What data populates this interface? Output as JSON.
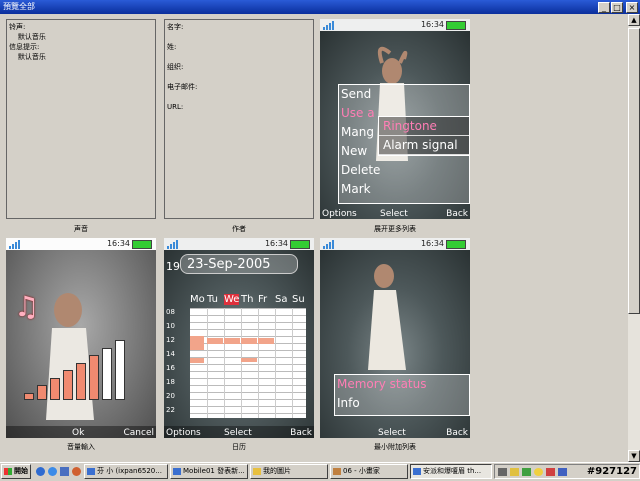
{
  "window": {
    "title": "預覽全部",
    "buttons": {
      "minimize": "_",
      "maximize": "□",
      "close": "×"
    }
  },
  "panels": {
    "sound": {
      "caption": "声音",
      "lines": [
        "铃声:",
        "    默认音乐",
        "信息提示:",
        "    默认音乐"
      ]
    },
    "author": {
      "caption": "作者",
      "lines": [
        "名字:",
        "",
        "姓:",
        "",
        "组织:",
        "",
        "电子邮件:",
        "",
        "URL:"
      ]
    }
  },
  "phones": {
    "common": {
      "time": "16:34"
    },
    "popup_list": {
      "caption": "展开更多列表",
      "menu": [
        "Send",
        "Use as",
        "Manage",
        "New",
        "Delete",
        "Mark"
      ],
      "menu_short": [
        "Send",
        "Use a",
        "Mang",
        "New",
        "Delete",
        "Mark"
      ],
      "submenu": [
        "Ringtone",
        "Alarm signal"
      ],
      "softkeys": {
        "left": "Options",
        "center": "Select",
        "right": "Back"
      }
    },
    "volume": {
      "caption": "音量輸入",
      "softkeys": {
        "left": "Ok",
        "right": "Cancel"
      },
      "levels": [
        1,
        2,
        3,
        4,
        5,
        6,
        7,
        8
      ]
    },
    "calendar": {
      "caption": "日历",
      "date": "23-Sep-2005",
      "week_no": "19",
      "weekdays": [
        "Mo",
        "Tu",
        "We",
        "Th",
        "Fr",
        "Sa",
        "Su"
      ],
      "selected_day": "We",
      "hours": [
        "08",
        "10",
        "12",
        "14",
        "16",
        "18",
        "20",
        "22"
      ],
      "softkeys": {
        "left": "Options",
        "center": "Select",
        "right": "Back"
      }
    },
    "mini_list": {
      "caption": "最小附加列表",
      "menu": [
        "Memory status",
        "Info"
      ],
      "softkeys": {
        "center": "Select",
        "right": "Back"
      }
    }
  },
  "taskbar": {
    "start": "開始",
    "items": [
      {
        "label": "芬 小 (ixpan6520...",
        "active": false
      },
      {
        "label": "Mobile01 發表新...",
        "active": false
      },
      {
        "label": "我的圖片",
        "active": false
      },
      {
        "label": "06 - 小畫家",
        "active": false
      },
      {
        "label": "安派和爆嗄眉 th...",
        "active": true
      }
    ],
    "clock": "#927127"
  },
  "colors": {
    "accent": "#ff7eb5",
    "calendar_event": "#f2a48a",
    "selected_day": "#e0303c"
  }
}
